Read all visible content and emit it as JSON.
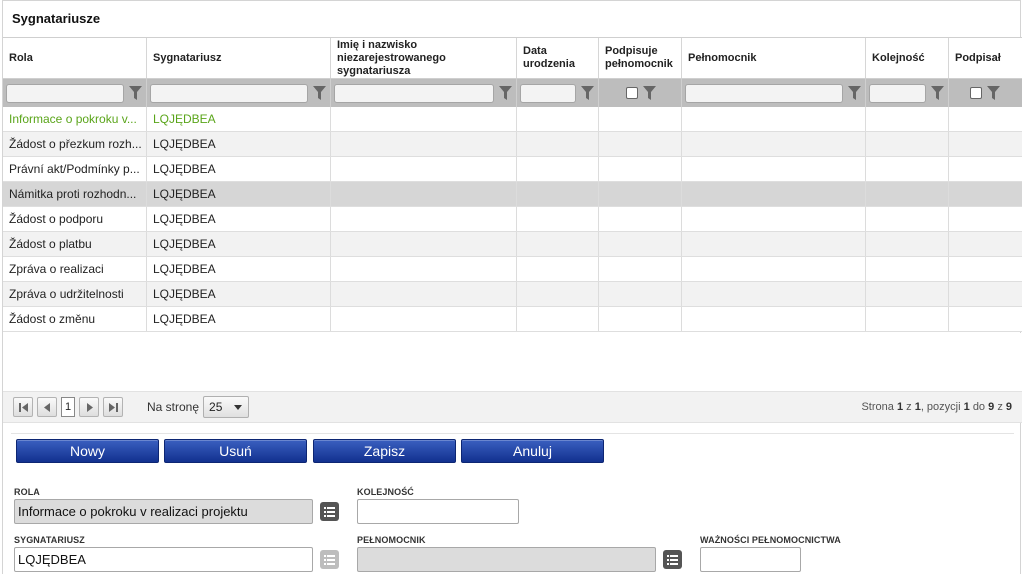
{
  "panel": {
    "title": "Sygnatariusze"
  },
  "columns": [
    {
      "label": "Rola"
    },
    {
      "label": "Sygnatariusz"
    },
    {
      "label": "Imię i nazwisko niezarejestrowanego sygnatariusza"
    },
    {
      "label": "Data urodzenia"
    },
    {
      "label": "Podpisuje pełnomocnik"
    },
    {
      "label": "Pełnomocnik"
    },
    {
      "label": "Kolejność"
    },
    {
      "label": "Podpisał"
    }
  ],
  "rows": [
    {
      "rola": "Informace o pokroku v...",
      "sygnatariusz": "LQJĘDBEA"
    },
    {
      "rola": "Žádost o přezkum rozh...",
      "sygnatariusz": "LQJĘDBEA"
    },
    {
      "rola": "Právní akt/Podmínky p...",
      "sygnatariusz": "LQJĘDBEA"
    },
    {
      "rola": "Námitka proti rozhodn...",
      "sygnatariusz": "LQJĘDBEA"
    },
    {
      "rola": "Žádost o podporu",
      "sygnatariusz": "LQJĘDBEA"
    },
    {
      "rola": "Žádost o platbu",
      "sygnatariusz": "LQJĘDBEA"
    },
    {
      "rola": "Zpráva o realizaci",
      "sygnatariusz": "LQJĘDBEA"
    },
    {
      "rola": "Zpráva o udržitelnosti",
      "sygnatariusz": "LQJĘDBEA"
    },
    {
      "rola": "Žádost o změnu",
      "sygnatariusz": "LQJĘDBEA"
    }
  ],
  "pager": {
    "current_page": "1",
    "per_page_label": "Na stronę",
    "per_page_value": "25",
    "info_prefix": "Strona",
    "info_page": "1",
    "info_of": "z",
    "info_total_pages": "1",
    "info_pos": ", pozycji",
    "info_from": "1",
    "info_to_word": "do",
    "info_to": "9",
    "info_of2": "z",
    "info_total": "9"
  },
  "buttons": {
    "new": "Nowy",
    "delete": "Usuń",
    "save": "Zapisz",
    "cancel": "Anuluj"
  },
  "form": {
    "rola_label": "ROLA",
    "rola_value": "Informace o pokroku v realizaci projektu",
    "kolejnosc_label": "KOLEJNOŚĆ",
    "kolejnosc_value": "",
    "sygnatariusz_label": "SYGNATARIUSZ",
    "sygnatariusz_value": "LQJĘDBEA",
    "pelnomocnik_label": "PEŁNOMOCNIK",
    "pelnomocnik_value": "",
    "waznosci_label": "WAŻNOŚCI PEŁNOMOCNICTWA",
    "waznosci_value": ""
  },
  "colors": {
    "active_row_text": "#5aa51a",
    "button_blue": "#1a3a9a",
    "filter_bar": "#bdbdbd"
  },
  "icons": {
    "filter": "funnel-icon",
    "list": "list-icon",
    "first": "first-page-icon",
    "prev": "prev-page-icon",
    "next": "next-page-icon",
    "last": "last-page-icon"
  }
}
